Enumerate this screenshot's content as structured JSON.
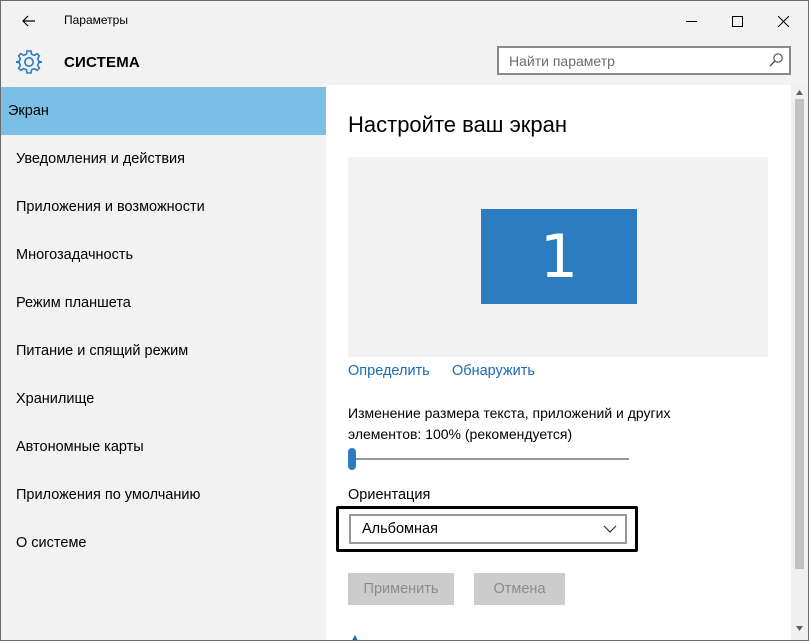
{
  "window": {
    "title": "Параметры",
    "back_icon": "arrow-left-icon",
    "minimize_icon": "minimize-icon",
    "maximize_icon": "maximize-icon",
    "close_icon": "close-icon"
  },
  "header": {
    "icon": "gear-icon",
    "title": "СИСТЕМА",
    "search_placeholder": "Найти параметр",
    "search_icon": "search-icon"
  },
  "sidebar": {
    "items": [
      {
        "label": "Экран",
        "active": true
      },
      {
        "label": "Уведомления и действия"
      },
      {
        "label": "Приложения и возможности"
      },
      {
        "label": "Многозадачность"
      },
      {
        "label": "Режим планшета"
      },
      {
        "label": "Питание и спящий режим"
      },
      {
        "label": "Хранилище"
      },
      {
        "label": "Автономные карты"
      },
      {
        "label": "Приложения по умолчанию"
      },
      {
        "label": "О системе"
      }
    ]
  },
  "main": {
    "page_title": "Настройте ваш экран",
    "monitor_number": "1",
    "identify_link": "Определить",
    "detect_link": "Обнаружить",
    "scale_label": "Изменение размера текста, приложений и других элементов: 100% (рекомендуется)",
    "scale_value_percent": 100,
    "orientation_label": "Ориентация",
    "orientation_value": "Альбомная",
    "apply_button": "Применить",
    "cancel_button": "Отмена"
  },
  "colors": {
    "accent": "#2b7cc1",
    "active_nav": "#7bbfe6",
    "link": "#1a6bb5",
    "panel_bg": "#f2f2f2"
  }
}
